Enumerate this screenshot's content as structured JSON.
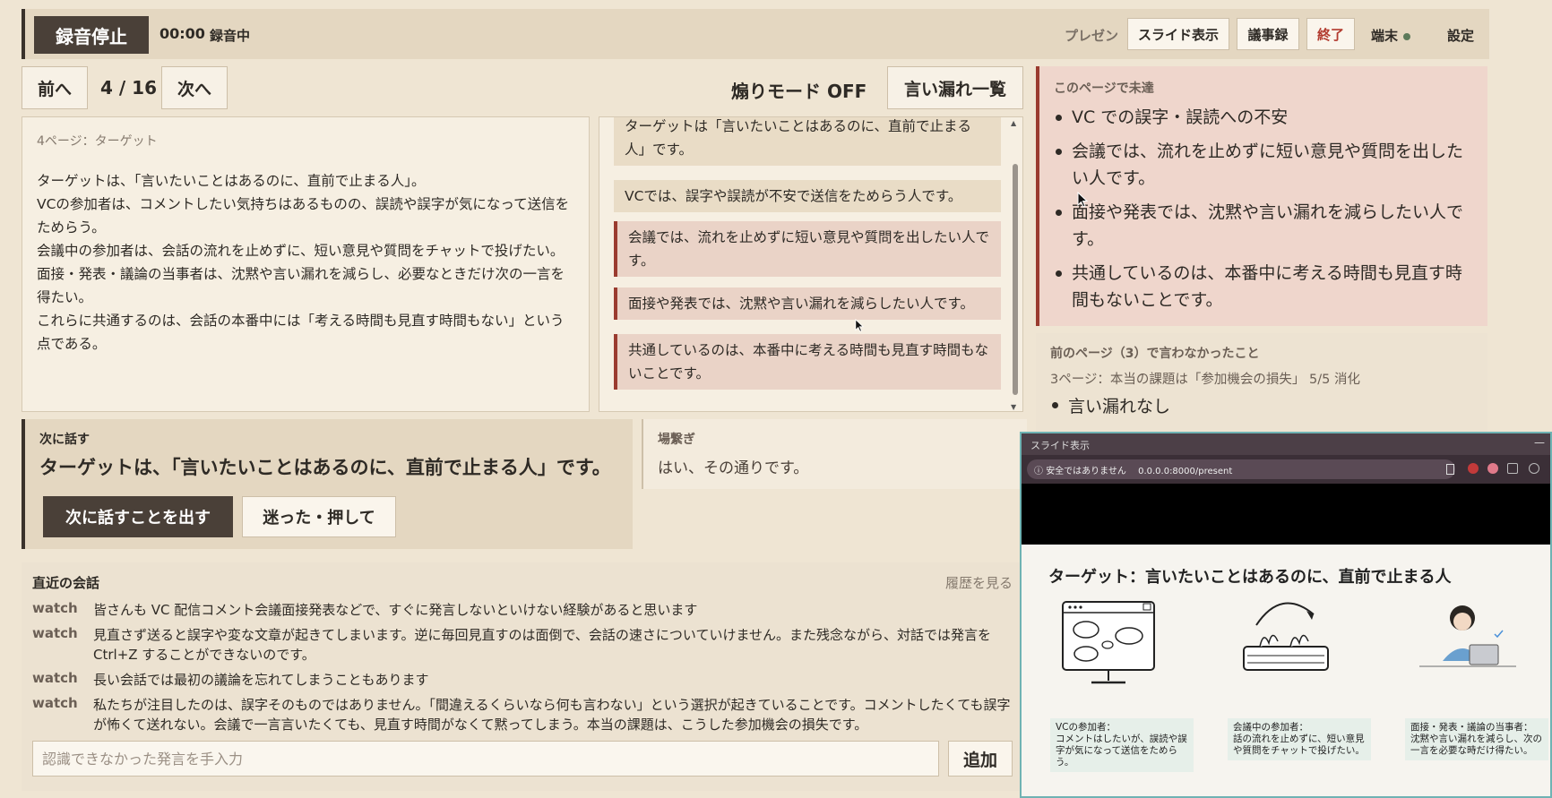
{
  "topbar": {
    "record_button": "録音停止",
    "timer": "00:00",
    "status": "録音中",
    "mode_label": "プレゼン",
    "slide_button": "スライド表示",
    "minutes_button": "議事録",
    "end_button": "終了",
    "terminal": "端末",
    "settings": "設定"
  },
  "nav": {
    "prev": "前へ",
    "page": "4 / 16",
    "next": "次へ",
    "aori_mode": "煽りモード OFF",
    "missed_list": "言い漏れ一覧"
  },
  "script": {
    "title": "4ページ：ターゲット",
    "lines": [
      "ターゲットは、「言いたいことはあるのに、直前で止まる人」。",
      "VCの参加者は、コメントしたい気持ちはあるものの、誤読や誤字が気になって送信をためらう。",
      "会議中の参加者は、会話の流れを止めずに、短い意見や質問をチャットで投げたい。",
      "面接・発表・議論の当事者は、沈黙や言い漏れを減らし、必要なときだけ次の一言を得たい。",
      "これらに共通するのは、会話の本番中には「考える時間も見直す時間もない」という点である。"
    ]
  },
  "sentences": [
    "ターゲットは「言いたいことはあるのに、直前で止まる人」です。",
    "VCでは、誤字や誤読が不安で送信をためらう人です。",
    "会議では、流れを止めずに短い意見や質問を出したい人です。",
    "面接や発表では、沈黙や言い漏れを減らしたい人です。",
    "共通しているのは、本番中に考える時間も見直す時間もないことです。"
  ],
  "missed": {
    "title": "このページで未達",
    "items": [
      "VC での誤字・誤読への不安",
      "会議では、流れを止めずに短い意見や質問を出したい人です。",
      "面接や発表では、沈黙や言い漏れを減らしたい人です。",
      "共通しているのは、本番中に考える時間も見直す時間もないことです。"
    ]
  },
  "previous": {
    "title": "前のページ（3）で言わなかったこと",
    "subtitle": "3ページ：本当の課題は「参加機会の損失」 5/5 消化",
    "item": "言い漏れなし"
  },
  "next_speak": {
    "title": "次に話す",
    "text": "ターゲットは、「言いたいことはあるのに、直前で止まる人」です。",
    "primary_button": "次に話すことを出す",
    "secondary_button": "迷った・押して"
  },
  "filler": {
    "title": "場繋ぎ",
    "text": "はい、その通りです。"
  },
  "conversation": {
    "title": "直近の会話",
    "history": "履歴を見る",
    "messages": [
      {
        "who": "watch",
        "text": "皆さんも VC 配信コメント会議面接発表などで、すぐに発言しないといけない経験があると思います"
      },
      {
        "who": "watch",
        "text": "見直さず送ると誤字や変な文章が起きてしまいます。逆に毎回見直すのは面倒で、会話の速さについていけません。また残念ながら、対話では発言を Ctrl+Z することができないのです。"
      },
      {
        "who": "watch",
        "text": "長い会話では最初の議論を忘れてしまうこともあります"
      },
      {
        "who": "watch",
        "text": "私たちが注目したのは、誤字そのものではありません。「間違えるくらいなら何も言わない」という選択が起きていることです。コメントしたくても誤字が怖くて送れない。会議で一言言いたくても、見直す時間がなくて黙ってしまう。本当の課題は、こうした参加機会の損失です。"
      }
    ],
    "input_placeholder": "認識できなかった発言を手入力",
    "add_button": "追加"
  },
  "popup": {
    "title": "スライド表示",
    "security": "安全ではありません",
    "url": "0.0.0.0:8000/present",
    "slide_title": "ターゲット：言いたいことはあるのに、直前で止まる人",
    "captions": [
      "VCの参加者：\nコメントはしたいが、誤読や誤字が気になって送信をためらう。",
      "会議中の参加者：\n話の流れを止めずに、短い意見や質問をチャットで投げたい。",
      "面接・発表・議論の当事者：\n沈黙や言い漏れを減らし、次の一言を必要な時だけ得たい。"
    ]
  },
  "colors": {
    "background": "#efe5d3",
    "accent_dark": "#4a4038",
    "missed_accent": "#9a3b2f",
    "popup_frame": "#6fb3b3"
  }
}
